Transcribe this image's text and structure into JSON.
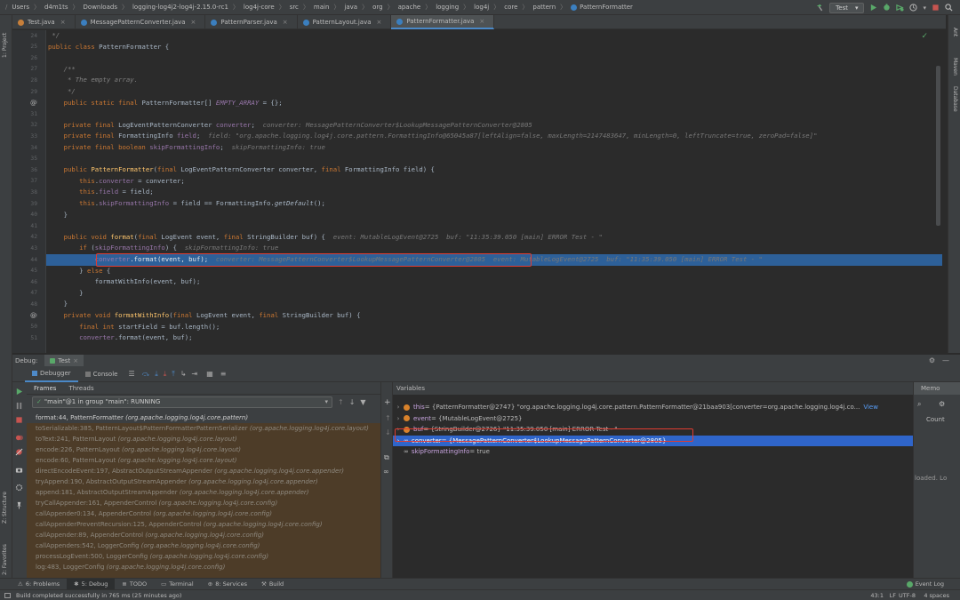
{
  "breadcrumbs": [
    "Users",
    "d4m1ts",
    "Downloads",
    "logging-log4j2-log4j-2.15.0-rc1",
    "log4j-core",
    "src",
    "main",
    "java",
    "org",
    "apache",
    "logging",
    "log4j",
    "core",
    "pattern",
    "PatternFormatter"
  ],
  "run_config": "Test",
  "tabs": [
    {
      "label": "Test.java",
      "active": false
    },
    {
      "label": "MessagePatternConverter.java",
      "active": false
    },
    {
      "label": "PatternParser.java",
      "active": false
    },
    {
      "label": "PatternLayout.java",
      "active": false
    },
    {
      "label": "PatternFormatter.java",
      "active": true
    }
  ],
  "stripes": {
    "project": "1: Project",
    "structure": "Z: Structure",
    "favorites": "2: Favorites",
    "ant": "Ant",
    "maven": "Maven",
    "database": "Database"
  },
  "editor": {
    "lines": [
      {
        "n": "24",
        "tokens": [
          {
            "c": "cm",
            "t": " */"
          }
        ]
      },
      {
        "n": "25",
        "tokens": [
          {
            "c": "kw",
            "t": "public class "
          },
          {
            "c": "",
            "t": "PatternFormatter {"
          }
        ]
      },
      {
        "n": "26",
        "tokens": []
      },
      {
        "n": "27",
        "tokens": [
          {
            "c": "cm",
            "t": "    /**"
          }
        ]
      },
      {
        "n": "28",
        "tokens": [
          {
            "c": "cm",
            "t": "     * The empty array."
          }
        ]
      },
      {
        "n": "29",
        "tokens": [
          {
            "c": "cm",
            "t": "     */"
          }
        ]
      },
      {
        "n": "30",
        "tokens": [
          {
            "c": "kw",
            "t": "    public static final "
          },
          {
            "c": "",
            "t": "PatternFormatter[] "
          },
          {
            "c": "fld ital",
            "t": "EMPTY_ARRAY"
          },
          {
            "c": "",
            "t": " = {};"
          }
        ]
      },
      {
        "n": "31",
        "tokens": []
      },
      {
        "n": "32",
        "tokens": [
          {
            "c": "kw",
            "t": "    private final "
          },
          {
            "c": "",
            "t": "LogEventPatternConverter "
          },
          {
            "c": "fld",
            "t": "converter"
          },
          {
            "c": "",
            "t": ";  "
          },
          {
            "c": "hint",
            "t": "converter: MessagePatternConverter$LookupMessagePatternConverter@2805"
          }
        ]
      },
      {
        "n": "33",
        "tokens": [
          {
            "c": "kw",
            "t": "    private final "
          },
          {
            "c": "",
            "t": "FormattingInfo "
          },
          {
            "c": "fld",
            "t": "field"
          },
          {
            "c": "",
            "t": ";  "
          },
          {
            "c": "hint",
            "t": "field: \"org.apache.logging.log4j.core.pattern.FormattingInfo@65045a87[leftAlign=false, maxLength=2147483647, minLength=0, leftTruncate=true, zeroPad=false]\""
          }
        ]
      },
      {
        "n": "34",
        "tokens": [
          {
            "c": "kw",
            "t": "    private final boolean "
          },
          {
            "c": "fld",
            "t": "skipFormattingInfo"
          },
          {
            "c": "",
            "t": ";  "
          },
          {
            "c": "hint",
            "t": "skipFormattingInfo: true"
          }
        ]
      },
      {
        "n": "35",
        "tokens": []
      },
      {
        "n": "36",
        "tokens": [
          {
            "c": "kw",
            "t": "    public "
          },
          {
            "c": "fn",
            "t": "PatternFormatter"
          },
          {
            "c": "",
            "t": "("
          },
          {
            "c": "kw",
            "t": "final "
          },
          {
            "c": "",
            "t": "LogEventPatternConverter converter, "
          },
          {
            "c": "kw",
            "t": "final "
          },
          {
            "c": "",
            "t": "FormattingInfo field) {"
          }
        ]
      },
      {
        "n": "37",
        "tokens": [
          {
            "c": "kw",
            "t": "        this"
          },
          {
            "c": "",
            "t": "."
          },
          {
            "c": "fld",
            "t": "converter"
          },
          {
            "c": "",
            "t": " = converter;"
          }
        ]
      },
      {
        "n": "38",
        "tokens": [
          {
            "c": "kw",
            "t": "        this"
          },
          {
            "c": "",
            "t": "."
          },
          {
            "c": "fld",
            "t": "field"
          },
          {
            "c": "",
            "t": " = field;"
          }
        ]
      },
      {
        "n": "39",
        "tokens": [
          {
            "c": "kw",
            "t": "        this"
          },
          {
            "c": "",
            "t": "."
          },
          {
            "c": "fld",
            "t": "skipFormattingInfo"
          },
          {
            "c": "",
            "t": " = field == FormattingInfo."
          },
          {
            "c": "ital",
            "t": "getDefault"
          },
          {
            "c": "",
            "t": "();"
          }
        ]
      },
      {
        "n": "40",
        "tokens": [
          {
            "c": "",
            "t": "    }"
          }
        ]
      },
      {
        "n": "41",
        "tokens": []
      },
      {
        "n": "42",
        "tokens": [
          {
            "c": "kw",
            "t": "    public void "
          },
          {
            "c": "fn",
            "t": "format"
          },
          {
            "c": "",
            "t": "("
          },
          {
            "c": "kw",
            "t": "final "
          },
          {
            "c": "",
            "t": "LogEvent event, "
          },
          {
            "c": "kw",
            "t": "final "
          },
          {
            "c": "",
            "t": "StringBuilder buf) {  "
          },
          {
            "c": "hint",
            "t": "event: MutableLogEvent@2725  buf: \"11:35:39.050 [main] ERROR Test - \""
          }
        ]
      },
      {
        "n": "43",
        "tokens": [
          {
            "c": "kw",
            "t": "        if "
          },
          {
            "c": "",
            "t": "("
          },
          {
            "c": "fld",
            "t": "skipFormattingInfo"
          },
          {
            "c": "",
            "t": ") {  "
          },
          {
            "c": "hint",
            "t": "skipFormattingInfo: true"
          }
        ]
      },
      {
        "n": "44",
        "tokens": [
          {
            "c": "fld",
            "t": "            converter"
          },
          {
            "c": "",
            "t": ".format(event, buf);  "
          },
          {
            "c": "hint",
            "t": "converter: MessagePatternConverter$LookupMessagePatternConverter@2805  event: MutableLogEvent@2725  buf: \"11:35:39.050 [main] ERROR Test - \""
          }
        ]
      },
      {
        "n": "45",
        "tokens": [
          {
            "c": "",
            "t": "        } "
          },
          {
            "c": "kw",
            "t": "else "
          },
          {
            "c": "",
            "t": "{"
          }
        ]
      },
      {
        "n": "46",
        "tokens": [
          {
            "c": "",
            "t": "            formatWithInfo(event, buf);"
          }
        ]
      },
      {
        "n": "47",
        "tokens": [
          {
            "c": "",
            "t": "        }"
          }
        ]
      },
      {
        "n": "48",
        "tokens": [
          {
            "c": "",
            "t": "    }"
          }
        ]
      },
      {
        "n": "49",
        "tokens": [
          {
            "c": "kw",
            "t": "    private void "
          },
          {
            "c": "fn",
            "t": "formatWithInfo"
          },
          {
            "c": "",
            "t": "("
          },
          {
            "c": "kw",
            "t": "final "
          },
          {
            "c": "",
            "t": "LogEvent event, "
          },
          {
            "c": "kw",
            "t": "final "
          },
          {
            "c": "",
            "t": "StringBuilder buf) {"
          }
        ]
      },
      {
        "n": "50",
        "tokens": [
          {
            "c": "kw",
            "t": "        final int "
          },
          {
            "c": "",
            "t": "startField = buf.length();"
          }
        ]
      },
      {
        "n": "51",
        "tokens": [
          {
            "c": "fld",
            "t": "        converter"
          },
          {
            "c": "",
            "t": ".format(event, buf);"
          }
        ]
      }
    ]
  },
  "debug": {
    "label": "Debug:",
    "session": "Test",
    "tab_debugger": "Debugger",
    "tab_console": "Console",
    "frames_tab": "Frames",
    "threads_tab": "Threads",
    "thread_select": "\"main\"@1 in group \"main\": RUNNING",
    "frames": [
      {
        "m": "format:44, PatternFormatter",
        "p": "(org.apache.logging.log4j.core.pattern)"
      },
      {
        "m": "toSerializable:385, PatternLayout$PatternFormatterPatternSerializer",
        "p": "(org.apache.logging.log4j.core.layout)"
      },
      {
        "m": "toText:241, PatternLayout",
        "p": "(org.apache.logging.log4j.core.layout)"
      },
      {
        "m": "encode:226, PatternLayout",
        "p": "(org.apache.logging.log4j.core.layout)"
      },
      {
        "m": "encode:60, PatternLayout",
        "p": "(org.apache.logging.log4j.core.layout)"
      },
      {
        "m": "directEncodeEvent:197, AbstractOutputStreamAppender",
        "p": "(org.apache.logging.log4j.core.appender)"
      },
      {
        "m": "tryAppend:190, AbstractOutputStreamAppender",
        "p": "(org.apache.logging.log4j.core.appender)"
      },
      {
        "m": "append:181, AbstractOutputStreamAppender",
        "p": "(org.apache.logging.log4j.core.appender)"
      },
      {
        "m": "tryCallAppender:161, AppenderControl",
        "p": "(org.apache.logging.log4j.core.config)"
      },
      {
        "m": "callAppender0:134, AppenderControl",
        "p": "(org.apache.logging.log4j.core.config)"
      },
      {
        "m": "callAppenderPreventRecursion:125, AppenderControl",
        "p": "(org.apache.logging.log4j.core.config)"
      },
      {
        "m": "callAppender:89, AppenderControl",
        "p": "(org.apache.logging.log4j.core.config)"
      },
      {
        "m": "callAppenders:542, LoggerConfig",
        "p": "(org.apache.logging.log4j.core.config)"
      },
      {
        "m": "processLogEvent:500, LoggerConfig",
        "p": "(org.apache.logging.log4j.core.config)"
      },
      {
        "m": "log:483, LoggerConfig",
        "p": "(org.apache.logging.log4j.core.config)"
      }
    ],
    "variables_title": "Variables",
    "variables": [
      {
        "name": "this",
        "value": " = {PatternFormatter@2747} \"org.apache.logging.log4j.core.pattern.PatternFormatter@21baa903[converter=org.apache.logging.log4j.co...",
        "link": "View",
        "icon": "orange-stack"
      },
      {
        "name": "event",
        "value": " = {MutableLogEvent@2725}",
        "icon": "orange"
      },
      {
        "name": "buf",
        "value": " = {StringBuilder@2726} \"11:35:39.050 [main] ERROR Test - \"",
        "icon": "orange"
      },
      {
        "name": "converter",
        "value": " = {MessagePatternConverter$LookupMessagePatternConverter@2805}",
        "icon": "watch",
        "selected": true
      },
      {
        "name": "skipFormattingInfo",
        "value": " = true",
        "icon": "watch"
      }
    ],
    "memory_tab": "Memo",
    "memory_count": "Count",
    "memory_status": "loaded. Lo"
  },
  "tool_tabs": [
    {
      "label": "6: Problems",
      "active": false
    },
    {
      "label": "5: Debug",
      "active": true
    },
    {
      "label": "TODO",
      "active": false
    },
    {
      "label": "Terminal",
      "active": false
    },
    {
      "label": "8: Services",
      "active": false
    },
    {
      "label": "Build",
      "active": false
    }
  ],
  "event_log": "Event Log",
  "status": {
    "message": "Build completed successfully in 765 ms (25 minutes ago)",
    "position": "43:1",
    "line_sep": "LF",
    "encoding": "UTF-8",
    "indent": "4 spaces"
  },
  "colors": {
    "accent": "#2f65ca",
    "exec_line": "#2d6099",
    "highlight": "#e03c31",
    "frames_bg": "#4d3c28"
  }
}
